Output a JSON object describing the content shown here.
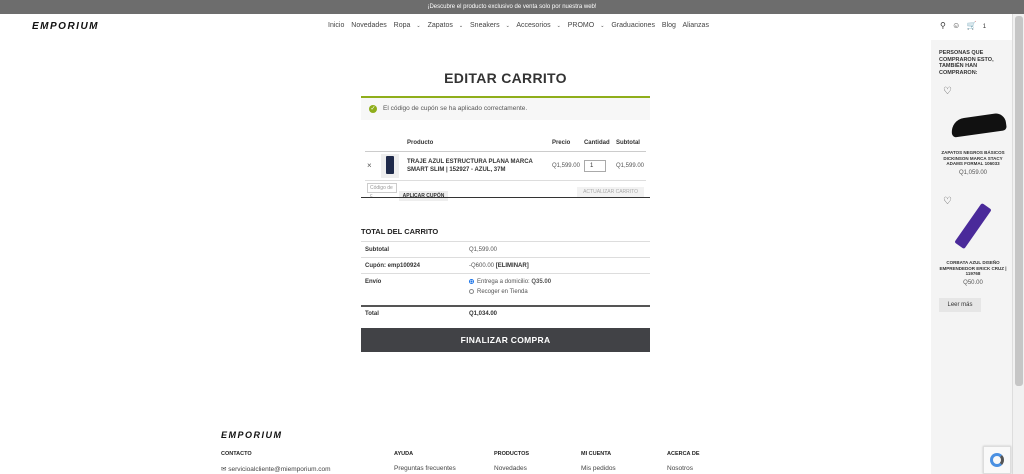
{
  "topbar": {
    "text": "¡Descubre el producto exclusivo de venta solo por nuestra web!"
  },
  "header": {
    "logo": "EMPORIUM",
    "nav": [
      "Inicio",
      "Novedades",
      "Ropa",
      "Zapatos",
      "Sneakers",
      "Accesorios",
      "PROMO",
      "Graduaciones",
      "Blog",
      "Alianzas"
    ],
    "cart_count": "1"
  },
  "page": {
    "title": "EDITAR CARRITO"
  },
  "notice": {
    "message": "El código de cupón se ha aplicado correctamente."
  },
  "cart": {
    "headers": {
      "product": "Producto",
      "price": "Precio",
      "quantity": "Cantidad",
      "subtotal": "Subtotal"
    },
    "item": {
      "remove": "×",
      "name": "TRAJE AZUL ESTRUCTURA PLANA MARCA SMART SLIM | 152927 - AZUL, 37M",
      "price": "Q1,599.00",
      "quantity": "1",
      "subtotal": "Q1,599.00"
    },
    "coupon_placeholder": "Código de c",
    "apply_label": "APLICAR CUPÓN",
    "update_label": "ACTUALIZAR CARRITO"
  },
  "totals": {
    "title": "TOTAL DEL CARRITO",
    "subtotal_label": "Subtotal",
    "subtotal_value": "Q1,599.00",
    "coupon_label": "Cupón: emp100924",
    "coupon_value": "-Q600.00",
    "coupon_remove": "[ELIMINAR]",
    "shipping_label": "Envío",
    "ship_option1": "Entrega a domicilio:",
    "ship_option1_price": "Q35.00",
    "ship_option2": "Recoger en Tienda",
    "total_label": "Total",
    "total_value": "Q1,034.00",
    "checkout_label": "FINALIZAR COMPRA"
  },
  "sidebar": {
    "title": "PERSONAS QUE COMPRARON ESTO, TAMBIÉN HAN COMPRARON:",
    "products": [
      {
        "name": "ZAPATOS NEGROS BÁSICOS DICKINSON MARCA STACY ADAMS FORMAL 106033",
        "price": "Q1,059.00"
      },
      {
        "name": "CORBATA AZUL DISEÑO EMPRENDEDOR ERICK CRUZ | 119768",
        "price": "Q50.00"
      }
    ],
    "read_more": "Leer más"
  },
  "footer": {
    "logo": "EMPORIUM",
    "columns": [
      {
        "title": "CONTACTO",
        "link": "servicioalcliente@miemporium.com"
      },
      {
        "title": "AYUDA",
        "link": "Preguntas frecuentes"
      },
      {
        "title": "PRODUCTOS",
        "link": "Novedades"
      },
      {
        "title": "MI CUENTA",
        "link": "Mis pedidos"
      },
      {
        "title": "ACERCA DE",
        "link": "Nosotros"
      }
    ]
  },
  "colors": {
    "accent": "#8fae1b",
    "checkout": "#414246",
    "topbar": "#6d6d6d"
  }
}
